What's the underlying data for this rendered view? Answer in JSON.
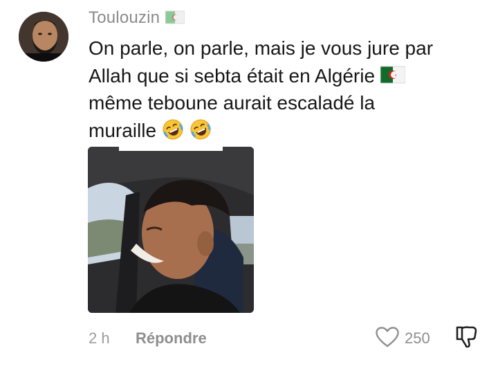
{
  "comment": {
    "username": "Toulouzin",
    "username_flag_icon": "algeria-flag-icon",
    "lines": [
      "On parle, on parle, mais je vous jure par",
      "Allah que si sebta était en Algérie",
      "même teboune aurait escaladé la",
      "muraille"
    ],
    "inline_flag_icon": "algeria-flag-icon",
    "trailing_emojis": [
      "rofl-emoji",
      "rofl-emoji"
    ],
    "time": "2 h",
    "reply_label": "Répondre",
    "like_count": "250"
  },
  "colors": {
    "username": "#8a8a8a",
    "text": "#161616",
    "meta": "#9a9a9a"
  }
}
